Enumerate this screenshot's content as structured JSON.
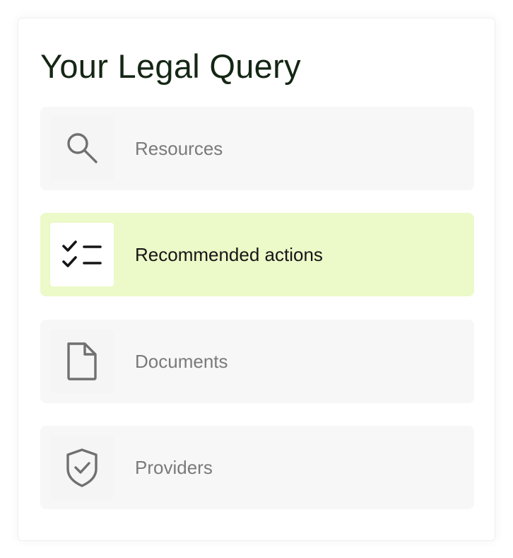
{
  "panel": {
    "title": "Your Legal Query",
    "items": [
      {
        "label": "Resources",
        "icon": "search-icon",
        "active": false
      },
      {
        "label": "Recommended actions",
        "icon": "checklist-icon",
        "active": true
      },
      {
        "label": "Documents",
        "icon": "document-icon",
        "active": false
      },
      {
        "label": "Providers",
        "icon": "shield-check-icon",
        "active": false
      }
    ]
  },
  "colors": {
    "title": "#142614",
    "active_background": "#ecf9c8",
    "item_background": "#f7f7f7",
    "icon": "#707070",
    "active_icon": "#151515"
  }
}
